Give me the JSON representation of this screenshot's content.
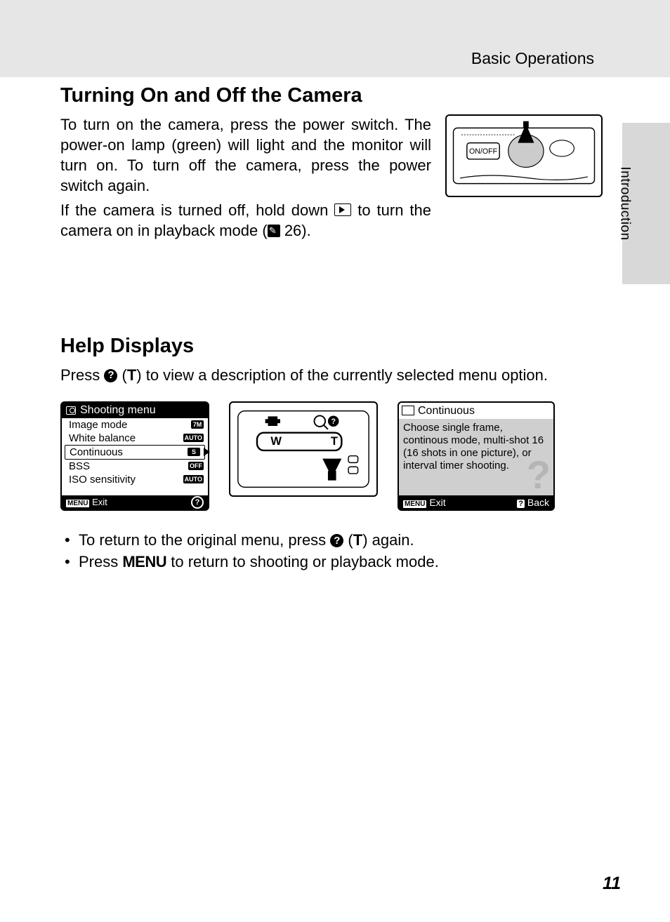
{
  "chapter_header": "Basic Operations",
  "side_tab": "Introduction",
  "page_number": "11",
  "section1": {
    "title": "Turning On and Off the Camera",
    "para1": "To turn on the camera, press the power switch. The power-on lamp (green) will light and the monitor will turn on. To turn off the camera, press the power switch again.",
    "para2a": "If the camera is turned off, hold down ",
    "para2b": " to turn the camera on in playback mode (",
    "para2c": " 26).",
    "camera_top_label": "ON/OFF"
  },
  "section2": {
    "title": "Help Displays",
    "intro_a": "Press ",
    "intro_b": " (",
    "intro_c": ") to view a description of the currently selected menu option.",
    "panel1": {
      "header": "Shooting menu",
      "rows": [
        {
          "label": "Image mode",
          "badge": "7M",
          "selected": false
        },
        {
          "label": "White balance",
          "badge": "AUTO",
          "selected": false
        },
        {
          "label": "Continuous",
          "badge": "S",
          "selected": true
        },
        {
          "label": "BSS",
          "badge": "OFF",
          "selected": false
        },
        {
          "label": "ISO sensitivity",
          "badge": "AUTO",
          "selected": false
        }
      ],
      "footer_menu": "MENU",
      "footer_exit": "Exit",
      "footer_help": "?"
    },
    "panel2": {
      "w_label": "W",
      "t_label": "T"
    },
    "panel3": {
      "header": "Continuous",
      "body": "Choose single frame, continous mode, multi-shot 16 (16 shots in one picture), or interval timer shooting.",
      "footer_menu": "MENU",
      "footer_exit": "Exit",
      "footer_help": "?",
      "footer_back": "Back"
    },
    "bullets": {
      "b1a": "To return to the original menu, press ",
      "b1b": " (",
      "b1c": ") again.",
      "b2a": "Press ",
      "b2_menu": "MENU",
      "b2b": " to return to shooting or playback mode."
    }
  }
}
